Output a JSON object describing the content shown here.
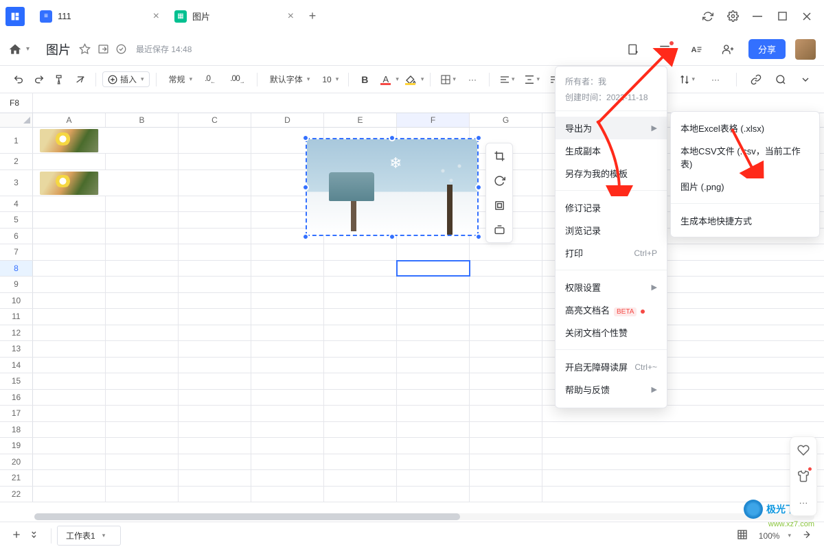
{
  "titlebar": {
    "tabs": [
      {
        "title": "111"
      },
      {
        "title": "图片"
      }
    ]
  },
  "header": {
    "doc_title": "图片",
    "save": "最近保存 14:48",
    "share": "分享"
  },
  "toolbar": {
    "insert": "插入",
    "normal": "常规",
    "decimal": ".0",
    "decimal2": ".00",
    "font": "默认字体",
    "size": "10",
    "bold": "B",
    "a": "A",
    "more": "···"
  },
  "namebox": {
    "cell": "F8"
  },
  "cols": [
    "A",
    "B",
    "C",
    "D",
    "E",
    "F",
    "G"
  ],
  "menu": {
    "owner_l": "所有者：",
    "owner_v": "我",
    "created_l": "创建时间：",
    "created_v": "2022-11-18",
    "export": "导出为",
    "copy": "生成副本",
    "save_tpl": "另存为我的模板",
    "history": "修订记录",
    "browse": "浏览记录",
    "print": "打印",
    "print_k": "Ctrl+P",
    "perm": "权限设置",
    "highlight": "高亮文档名",
    "beta": "BETA",
    "close_like": "关闭文档个性赞",
    "barrier": "开启无障碍读屏",
    "barrier_k": "Ctrl+~",
    "help": "帮助与反馈"
  },
  "submenu": {
    "xlsx": "本地Excel表格 (.xlsx)",
    "csv": "本地CSV文件 (.csv，当前工作表)",
    "png": "图片 (.png)",
    "shortcut": "生成本地快捷方式"
  },
  "statusbar": {
    "sheet": "工作表1",
    "zoom": "100%"
  },
  "watermark": {
    "text": "极光下载站",
    "sub": "www.xz7.com"
  }
}
